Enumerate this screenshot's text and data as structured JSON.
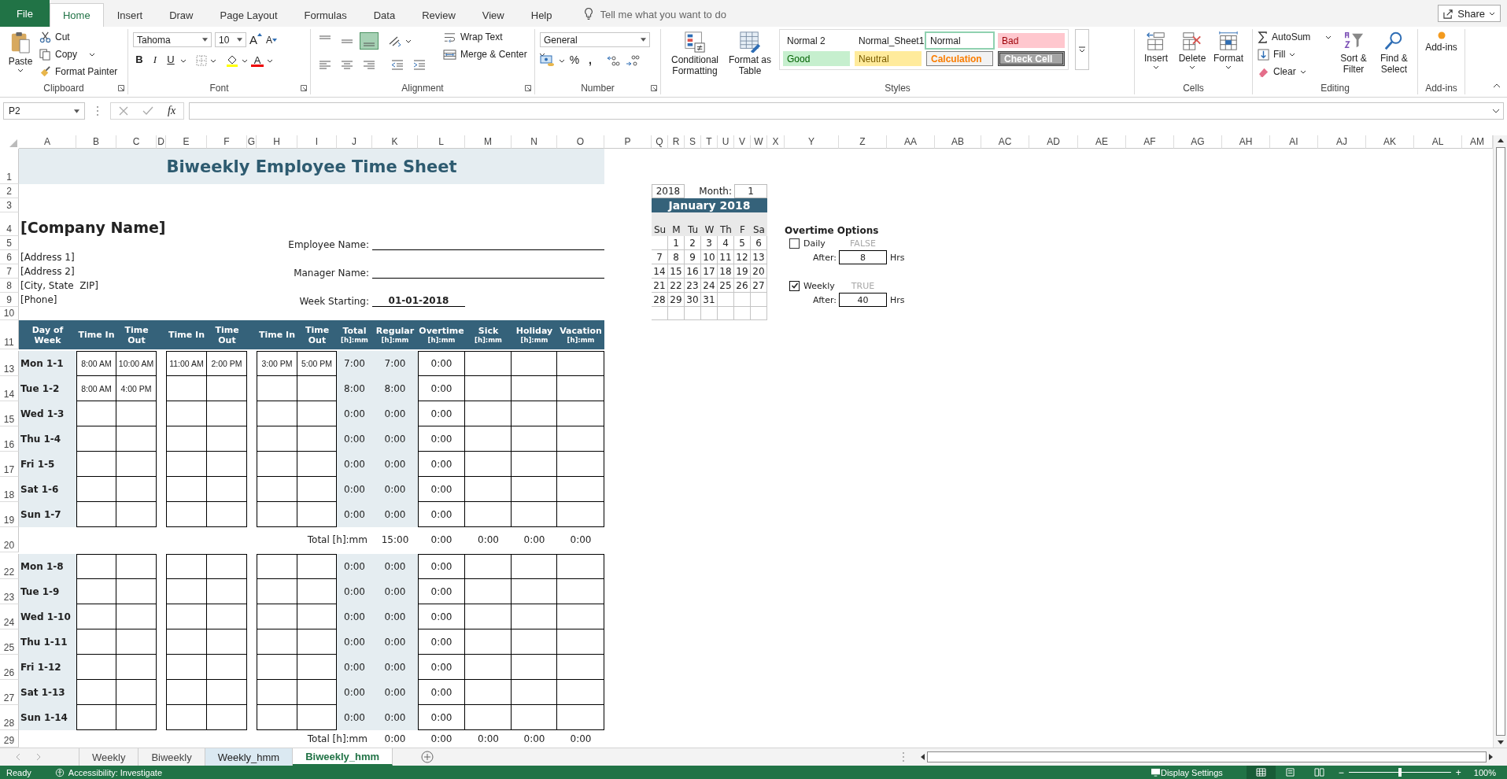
{
  "menu_tabs": [
    {
      "label": "File",
      "kind": "file",
      "selected": false
    },
    {
      "label": "Home",
      "kind": "tab",
      "selected": true
    },
    {
      "label": "Insert",
      "kind": "tab",
      "selected": false
    },
    {
      "label": "Draw",
      "kind": "tab",
      "selected": false
    },
    {
      "label": "Page Layout",
      "kind": "tab",
      "selected": false
    },
    {
      "label": "Formulas",
      "kind": "tab",
      "selected": false
    },
    {
      "label": "Data",
      "kind": "tab",
      "selected": false
    },
    {
      "label": "Review",
      "kind": "tab",
      "selected": false
    },
    {
      "label": "View",
      "kind": "tab",
      "selected": false
    },
    {
      "label": "Help",
      "kind": "tab",
      "selected": false
    }
  ],
  "tell_me": {
    "placeholder": "Tell me what you want to do"
  },
  "share": {
    "label": "Share"
  },
  "ribbon": {
    "clipboard": {
      "label": "Clipboard",
      "paste": "Paste",
      "cut": "Cut",
      "copy": "Copy",
      "painter": "Format Painter"
    },
    "font": {
      "label": "Font",
      "name": "Tahoma",
      "size": "10",
      "grow": "A",
      "shrink": "A",
      "bold": "B",
      "italic": "I",
      "underline": "U",
      "font_color": "A"
    },
    "alignment": {
      "label": "Alignment",
      "vertical": [
        {
          "kind": "top",
          "selected": false
        },
        {
          "kind": "middle",
          "selected": false
        },
        {
          "kind": "bottom",
          "selected": true
        }
      ],
      "wrap": "Wrap Text",
      "merge": "Merge & Center"
    },
    "number": {
      "label": "Number",
      "format": "General",
      "percent": "%",
      "comma": ","
    },
    "styles": {
      "label": "Styles",
      "conditional": "Conditional Formatting",
      "table": "Format as Table",
      "gallery": [
        {
          "label": "Normal 2",
          "kind": "plain",
          "selected": false
        },
        {
          "label": "Normal_Sheet1",
          "kind": "plain",
          "selected": false
        },
        {
          "label": "Normal",
          "kind": "plain",
          "selected": true
        },
        {
          "label": "Bad",
          "kind": "bad",
          "selected": false
        },
        {
          "label": "Good",
          "kind": "good",
          "selected": false
        },
        {
          "label": "Neutral",
          "kind": "neutral",
          "selected": false
        },
        {
          "label": "Calculation",
          "kind": "calculation",
          "selected": false
        },
        {
          "label": "Check Cell",
          "kind": "check",
          "selected": false
        }
      ]
    },
    "cells": {
      "label": "Cells",
      "insert": "Insert",
      "delete": "Delete",
      "format": "Format"
    },
    "editing": {
      "label": "Editing",
      "autosum": "AutoSum",
      "fill": "Fill",
      "clear": "Clear",
      "sort": "Sort & Filter",
      "find": "Find & Select"
    },
    "addins": {
      "label": "Add-ins",
      "button": "Add-ins"
    }
  },
  "formula_bar": {
    "name_box": "P2",
    "function_label": "fx"
  },
  "columns": [
    "A",
    "B",
    "C",
    "D",
    "E",
    "F",
    "G",
    "H",
    "I",
    "J",
    "K",
    "L",
    "M",
    "N",
    "O",
    "P",
    "Q",
    "R",
    "S",
    "T",
    "U",
    "V",
    "W",
    "X",
    "Y",
    "Z",
    "AA",
    "AB",
    "AC",
    "AD",
    "AE",
    "AF",
    "AG",
    "AH",
    "AI",
    "AJ",
    "AK",
    "AL",
    "AM"
  ],
  "row_numbers": [
    "1",
    "2",
    "3",
    "4",
    "5",
    "6",
    "7",
    "8",
    "9",
    "10",
    "11",
    "13",
    "14",
    "15",
    "16",
    "17",
    "18",
    "19",
    "20",
    "22",
    "23",
    "24",
    "25",
    "26",
    "27",
    "28",
    "29"
  ],
  "sheet": {
    "title": "Biweekly Employee Time Sheet",
    "company": "[Company Name]",
    "address": [
      "[Address 1]",
      "[Address 2]",
      "[City, State  ZIP]",
      "[Phone]"
    ],
    "fields": [
      {
        "label": "Employee Name:"
      },
      {
        "label": "Manager Name:"
      },
      {
        "label": "Week Starting:",
        "value": "01-01-2018"
      }
    ],
    "calendar": {
      "year": "2018",
      "month_label": "Month:",
      "month": "1",
      "title": "January 2018",
      "weekdays": [
        "Su",
        "M",
        "Tu",
        "W",
        "Th",
        "F",
        "Sa"
      ],
      "weeks": [
        {
          "leading_blank": true,
          "days": [
            "1",
            "2",
            "3",
            "4",
            "5",
            "6"
          ]
        },
        {
          "leading_blank": false,
          "days": [
            "7",
            "8",
            "9",
            "10",
            "11",
            "12",
            "13"
          ]
        },
        {
          "leading_blank": false,
          "days": [
            "14",
            "15",
            "16",
            "17",
            "18",
            "19",
            "20"
          ]
        },
        {
          "leading_blank": false,
          "days": [
            "21",
            "22",
            "23",
            "24",
            "25",
            "26",
            "27"
          ]
        },
        {
          "leading_blank": false,
          "days": [
            "28",
            "29",
            "30",
            "31"
          ]
        }
      ]
    },
    "overtime": {
      "title": "Overtime Options",
      "options": [
        {
          "label": "Daily",
          "checked": false,
          "flag": "FALSE",
          "after_label": "After:",
          "value": "8",
          "unit": "Hrs"
        },
        {
          "label": "Weekly",
          "checked": true,
          "flag": "TRUE",
          "after_label": "After:",
          "value": "40",
          "unit": "Hrs"
        }
      ]
    },
    "headers": [
      {
        "label": "Day of Week"
      },
      {
        "label": "Time In"
      },
      {
        "label": "Time Out"
      },
      {
        "label": "Time In"
      },
      {
        "label": "Time Out"
      },
      {
        "label": "Time In"
      },
      {
        "label": "Time Out"
      },
      {
        "label": "Total",
        "unit": "[h]:mm"
      },
      {
        "label": "Regular",
        "unit": "[h]:mm"
      },
      {
        "label": "Overtime",
        "unit": "[h]:mm"
      },
      {
        "label": "Sick",
        "unit": "[h]:mm"
      },
      {
        "label": "Holiday",
        "unit": "[h]:mm"
      },
      {
        "label": "Vacation",
        "unit": "[h]:mm"
      }
    ],
    "weeks": [
      {
        "days": [
          {
            "day": "Mon 1-1",
            "times": [
              "8:00 AM",
              "10:00 AM",
              "11:00 AM",
              "2:00 PM",
              "3:00 PM",
              "5:00 PM"
            ],
            "total": "7:00",
            "regular": "7:00",
            "overtime": "0:00"
          },
          {
            "day": "Tue 1-2",
            "times": [
              "8:00 AM",
              "4:00 PM"
            ],
            "total": "8:00",
            "regular": "8:00",
            "overtime": "0:00"
          },
          {
            "day": "Wed 1-3",
            "total": "0:00",
            "regular": "0:00",
            "overtime": "0:00"
          },
          {
            "day": "Thu 1-4",
            "total": "0:00",
            "regular": "0:00",
            "overtime": "0:00"
          },
          {
            "day": "Fri 1-5",
            "total": "0:00",
            "regular": "0:00",
            "overtime": "0:00"
          },
          {
            "day": "Sat 1-6",
            "total": "0:00",
            "regular": "0:00",
            "overtime": "0:00"
          },
          {
            "day": "Sun 1-7",
            "total": "0:00",
            "regular": "0:00",
            "overtime": "0:00"
          }
        ],
        "total_label": "Total [h]:mm",
        "totals": [
          "15:00",
          "0:00",
          "0:00",
          "0:00",
          "0:00"
        ]
      },
      {
        "days": [
          {
            "day": "Mon 1-8",
            "total": "0:00",
            "regular": "0:00",
            "overtime": "0:00"
          },
          {
            "day": "Tue 1-9",
            "total": "0:00",
            "regular": "0:00",
            "overtime": "0:00"
          },
          {
            "day": "Wed 1-10",
            "total": "0:00",
            "regular": "0:00",
            "overtime": "0:00"
          },
          {
            "day": "Thu 1-11",
            "total": "0:00",
            "regular": "0:00",
            "overtime": "0:00"
          },
          {
            "day": "Fri 1-12",
            "total": "0:00",
            "regular": "0:00",
            "overtime": "0:00"
          },
          {
            "day": "Sat 1-13",
            "total": "0:00",
            "regular": "0:00",
            "overtime": "0:00"
          },
          {
            "day": "Sun 1-14",
            "total": "0:00",
            "regular": "0:00",
            "overtime": "0:00"
          }
        ],
        "total_label": "Total [h]:mm",
        "totals": [
          "0:00",
          "0:00",
          "0:00",
          "0:00",
          "0:00"
        ]
      }
    ]
  },
  "sheet_tabs": [
    {
      "label": "Weekly",
      "selected": false,
      "tinted": false
    },
    {
      "label": "Biweekly",
      "selected": false,
      "tinted": false
    },
    {
      "label": "Weekly_hmm",
      "selected": false,
      "tinted": true
    },
    {
      "label": "Biweekly_hmm",
      "selected": true,
      "tinted": false
    }
  ],
  "status_bar": {
    "mode": "Ready",
    "accessibility": "Accessibility: Investigate",
    "display_settings": "Display Settings",
    "views": [
      {
        "kind": "normal",
        "selected": true
      },
      {
        "kind": "page-layout",
        "selected": false
      },
      {
        "kind": "page-break",
        "selected": false
      }
    ],
    "zoom_out": "−",
    "zoom_in": "+",
    "zoom_slider": {
      "level": 0.5
    },
    "zoom": "100%"
  }
}
